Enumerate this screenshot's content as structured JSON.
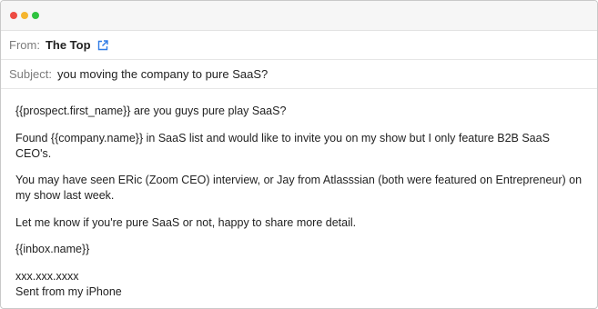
{
  "email": {
    "from_label": "From:",
    "from_name": "The Top",
    "subject_label": "Subject:",
    "subject": "you moving the company to pure SaaS?",
    "body": {
      "p1": "{{prospect.first_name}} are you guys pure play SaaS?",
      "p2": "Found {{company.name}} in SaaS list and would like to invite you on my show but I only feature B2B SaaS CEO's.",
      "p3": "You may have seen ERic (Zoom CEO) interview, or Jay from Atlasssian (both were featured on Entrepreneur) on my show last week.",
      "p4": "Let me know if you're pure SaaS or not, happy to share more detail.",
      "p5": "{{inbox.name}}",
      "signature_line1": "xxx.xxx.xxxx",
      "signature_line2": "Sent from my iPhone"
    }
  },
  "icons": {
    "external_link": "external-link-icon"
  },
  "colors": {
    "link_blue": "#2f7be5",
    "close": "#ed4b43",
    "minimize": "#f5b52e",
    "zoom": "#2ec33f"
  }
}
